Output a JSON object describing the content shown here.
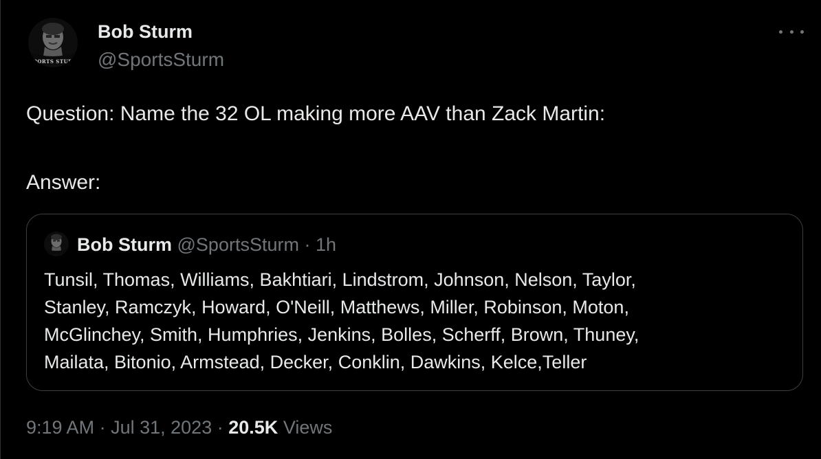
{
  "author": {
    "display_name": "Bob Sturm",
    "handle": "@SportsSturm",
    "avatar_icon": "sports-sturm-logo-avatar",
    "avatar_text": "SPORTS STURM"
  },
  "tweet": {
    "question": "Question: Name the 32 OL making more AAV than Zack Martin:",
    "answer_label": "Answer:"
  },
  "quoted_tweet": {
    "display_name": "Bob Sturm",
    "handle": "@SportsSturm",
    "separator": "·",
    "time": "1h",
    "lines": [
      "Tunsil, Thomas, Williams, Bakhtiari, Lindstrom, Johnson, Nelson, Taylor,",
      "Stanley, Ramczyk, Howard, O'Neill, Matthews, Miller, Robinson, Moton,",
      "McGlinchey, Smith, Humphries, Jenkins, Bolles, Scherff, Brown, Thuney,",
      "Mailata, Bitonio, Armstead, Decker, Conklin, Dawkins, Kelce,Teller"
    ]
  },
  "meta": {
    "time": "9:19 AM",
    "separator": "·",
    "date": "Jul 31, 2023",
    "views_count": "20.5K",
    "views_label": "Views"
  },
  "colors": {
    "background": "#000000",
    "primary_text": "#e7e9ea",
    "secondary_text": "#71767b",
    "border": "#3b4045"
  }
}
